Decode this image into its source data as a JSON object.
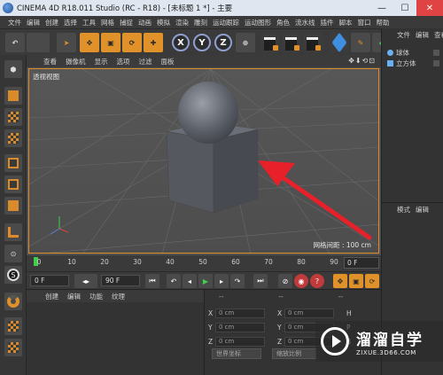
{
  "window": {
    "title": "CINEMA 4D R18.011 Studio (RC - R18) - [未标题 1 *] - 主要",
    "minimize": "—",
    "maximize": "☐",
    "close": "✕"
  },
  "menubar": [
    "文件",
    "编辑",
    "创建",
    "选择",
    "工具",
    "网格",
    "捕捉",
    "动画",
    "模拟",
    "渲染",
    "雕刻",
    "运动跟踪",
    "运动图形",
    "角色",
    "流水线",
    "插件",
    "脚本",
    "窗口",
    "帮助"
  ],
  "toolbar": {
    "undo": "↶",
    "x_axis": "X",
    "y_axis": "Y",
    "z_axis": "Z"
  },
  "viewport": {
    "menu": [
      "查看",
      "摄像机",
      "显示",
      "选项",
      "过滤",
      "面板"
    ],
    "nav_icons": "✥⬇⟲⊡",
    "label": "透视视图",
    "grid_readout": "网格间距 : 100 cm"
  },
  "timeline": {
    "ticks": [
      "0",
      "10",
      "20",
      "30",
      "40",
      "50",
      "60",
      "70",
      "80",
      "90"
    ],
    "current_frame": "0 F"
  },
  "transport": {
    "start_field": "0 F",
    "end_field": "90 F"
  },
  "material_manager": {
    "menu": [
      "创建",
      "编辑",
      "功能",
      "纹理"
    ]
  },
  "coordinates": {
    "head": [
      "--",
      "--",
      "--"
    ],
    "rows": [
      {
        "axis": "X",
        "pos": "0 cm",
        "size": "0 cm",
        "rot_label": "H",
        "rot": "0 °"
      },
      {
        "axis": "Y",
        "pos": "0 cm",
        "size": "0 cm",
        "rot_label": "P",
        "rot": "0 °"
      },
      {
        "axis": "Z",
        "pos": "0 cm",
        "size": "0 cm",
        "rot_label": "B",
        "rot": "0 °"
      }
    ],
    "world_dropdown": "世界坐标",
    "scale_dropdown": "缩放比例"
  },
  "object_manager": {
    "tabs": [
      "文件",
      "编辑",
      "查看"
    ],
    "items": [
      "球体",
      "立方体"
    ]
  },
  "attribute_manager": {
    "tabs": [
      "模式",
      "编辑"
    ]
  },
  "watermark": {
    "name": "溜溜自学",
    "url": "ZIXUE.3D66.COM"
  },
  "colors": {
    "accent_orange": "#e0912a",
    "annotation_arrow": "#e8202a",
    "viewport_bg": "#505050",
    "object_blue": "#6ab0f0"
  }
}
